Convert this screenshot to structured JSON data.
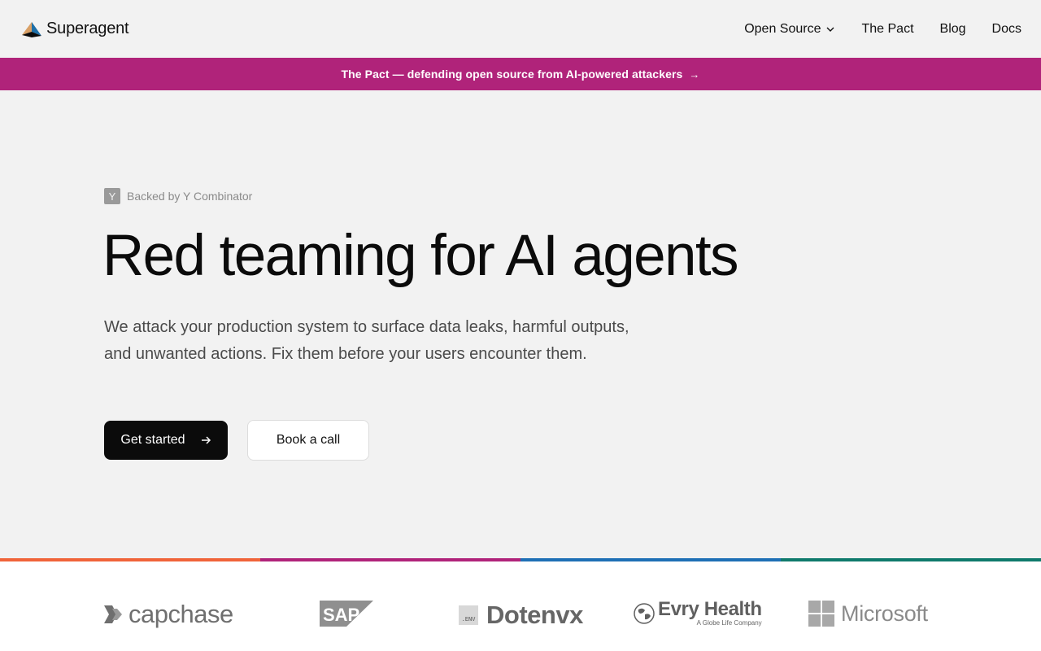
{
  "header": {
    "brand_name": "Superagent",
    "nav": {
      "open_source": "Open Source",
      "the_pact": "The Pact",
      "blog": "Blog",
      "docs": "Docs"
    }
  },
  "banner": {
    "text": "The Pact — defending open source from AI-powered attackers",
    "arrow": "→"
  },
  "hero": {
    "yc_letter": "Y",
    "backed_by": "Backed by Y Combinator",
    "headline": "Red teaming for AI agents",
    "subtext": "We attack your production system to surface data leaks, harmful outputs, and unwanted actions. Fix them before your users encounter them.",
    "primary_button": "Get started",
    "secondary_button": "Book a call"
  },
  "stripe_colors": [
    "#f0643a",
    "#b0237a",
    "#1e6fb5",
    "#0f7a6c"
  ],
  "logos": {
    "capchase": "capchase",
    "sap": "SAP",
    "dotenvx_env": ".ENV",
    "dotenvx": "Dotenvx",
    "evry": "Evry Health",
    "evry_sub": "A Globe Life Company",
    "microsoft": "Microsoft"
  },
  "colors": {
    "banner": "#b0237a",
    "primary_button": "#0b0b0b",
    "background": "#f2f2f2"
  }
}
